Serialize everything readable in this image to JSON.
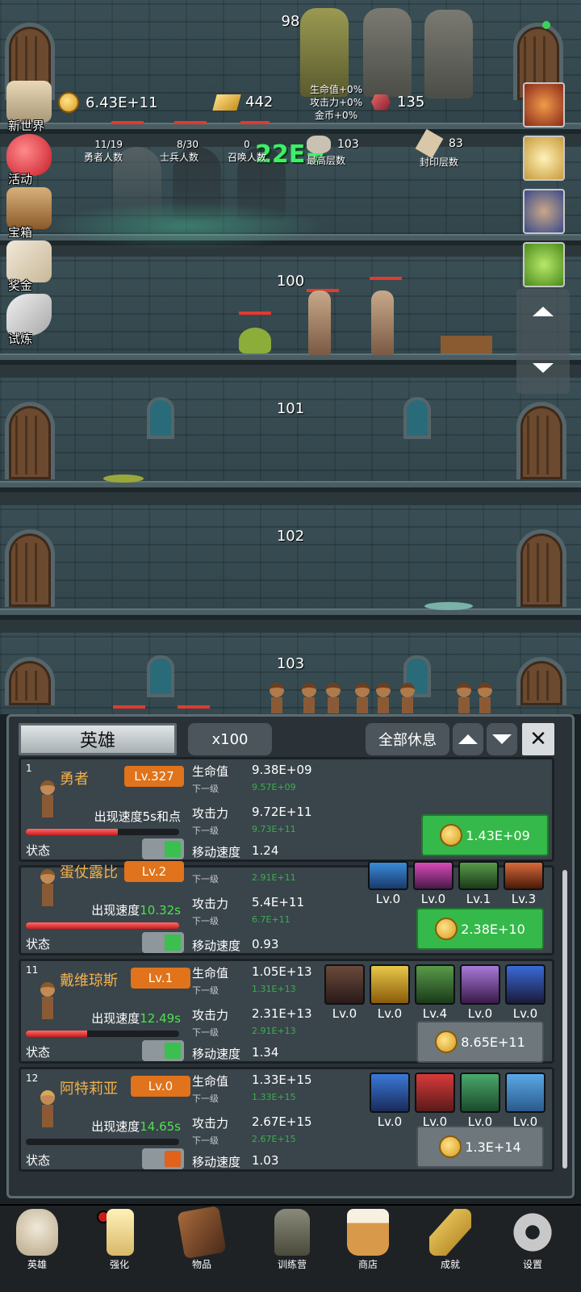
{
  "floors": [
    "98",
    "100",
    "101",
    "102",
    "103"
  ],
  "damage_popup": "22E+",
  "buff_text": {
    "hp": "生命值+0%",
    "attack": "攻击力+0%",
    "gold": "金币+0%"
  },
  "currency": {
    "gold": "6.43E+11",
    "gold_bars": "442",
    "gems": "135"
  },
  "stats": {
    "heroes": {
      "value": "11/19",
      "label": "勇者人数"
    },
    "soldiers": {
      "value": "8/30",
      "label": "士兵人数"
    },
    "summons": {
      "value": "0",
      "label": "召唤人数"
    },
    "max_floor": {
      "value": "103",
      "label": "最高层数"
    },
    "sealed_floor": {
      "value": "83",
      "label": "封印层数"
    }
  },
  "side_menu": [
    "新世界",
    "活动",
    "宝箱",
    "奖金",
    "试炼"
  ],
  "right_slots": [
    "apple-icon",
    "candle-icon",
    "chest-icon",
    "slime-icon"
  ],
  "panel": {
    "title": "英雄",
    "multiplier": "x100",
    "rest_all": "全部休息"
  },
  "labels": {
    "hp": "生命值",
    "next": "下一级",
    "attack": "攻击力",
    "move_speed": "移动速度",
    "appear_speed": "出现速度",
    "status": "状态"
  },
  "heroes": [
    {
      "index": "1",
      "name": "勇者",
      "level": "Lv.327",
      "appear": "5s和点",
      "hp": "9.38E+09",
      "hp_next": "9.57E+09",
      "atk": "9.72E+11",
      "atk_next": "9.73E+11",
      "move": "1.24",
      "cost": "1.43E+09",
      "hp_bar": 0.6,
      "status_on": true,
      "skills": []
    },
    {
      "index": "",
      "name": "蛋仗露比",
      "level": "Lv.2",
      "appear": "10.32s",
      "hp": "",
      "hp_next": "2.91E+11",
      "atk": "5.4E+11",
      "atk_next": "6.7E+11",
      "move": "0.93",
      "cost": "2.38E+10",
      "hp_bar": 1.0,
      "status_on": true,
      "skills": [
        "Lv.0",
        "Lv.0",
        "Lv.1",
        "Lv.3"
      ]
    },
    {
      "index": "11",
      "name": "戴维琼斯",
      "level": "Lv.1",
      "appear": "12.49s",
      "hp": "1.05E+13",
      "hp_next": "1.31E+13",
      "atk": "2.31E+13",
      "atk_next": "2.91E+13",
      "move": "1.34",
      "cost": "8.65E+11",
      "hp_bar": 0.4,
      "status_on": true,
      "skills": [
        "Lv.0",
        "Lv.0",
        "Lv.4",
        "Lv.0",
        "Lv.0"
      ]
    },
    {
      "index": "12",
      "name": "阿特莉亚",
      "level": "Lv.0",
      "appear": "14.65s",
      "hp": "1.33E+15",
      "hp_next": "1.33E+15",
      "atk": "2.67E+15",
      "atk_next": "2.67E+15",
      "move": "1.03",
      "cost": "1.3E+14",
      "hp_bar": 0.0,
      "status_on": false,
      "skills": [
        "Lv.0",
        "Lv.0",
        "Lv.0",
        "Lv.0"
      ]
    }
  ],
  "nav": [
    "英雄",
    "强化",
    "物品",
    "训练营",
    "商店",
    "成就",
    "设置"
  ],
  "colors": {
    "accent_green": "#35b94a",
    "level_orange": "#e0731b",
    "name_gold": "#f2b24a",
    "stat_green": "#4ee04e"
  }
}
